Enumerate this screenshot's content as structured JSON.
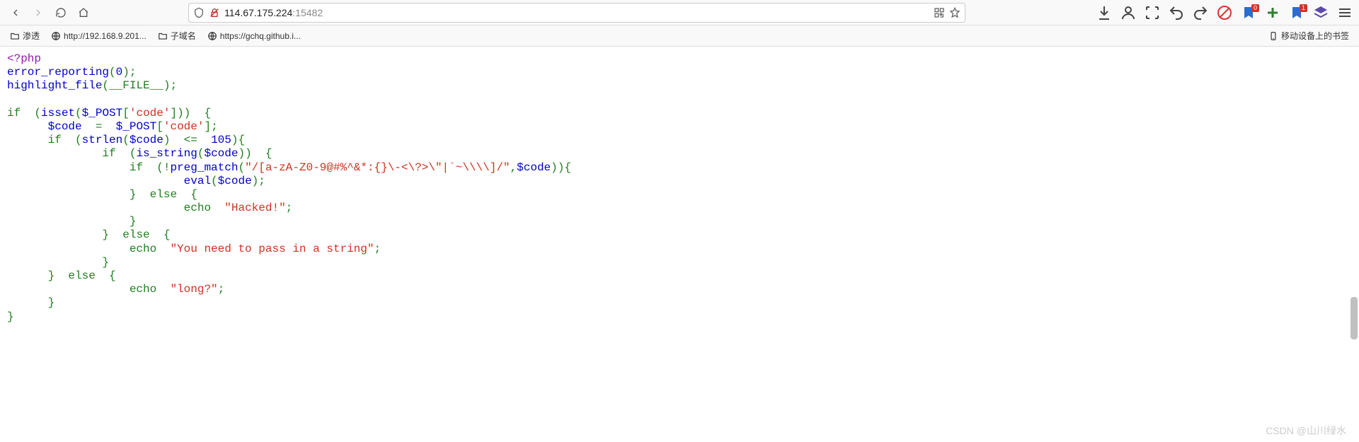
{
  "address": {
    "host": "114.67.175.224",
    "port": ":15482"
  },
  "bookmarks": {
    "b1": "渗透",
    "b2": "http://192.168.9.201...",
    "b3": "子域名",
    "b4": "https://gchq.github.i...",
    "mobile": "移动设备上的书签"
  },
  "icons": {
    "badge_notify": "0",
    "badge_ext": "1"
  },
  "code": {
    "l01_open": "<?php",
    "l02_fn": "error_reporting",
    "l02_arg": "0",
    "l03_fn": "highlight_file",
    "l03_arg": "__FILE__",
    "l05_if": "if",
    "l05_isset": "isset",
    "l05_post": "$_POST",
    "l05_key": "'code'",
    "l06_var": "$code",
    "l06_post": "$_POST",
    "l06_key": "'code'",
    "l07_if": "if",
    "l07_strlen": "strlen",
    "l07_var": "$code",
    "l07_num": "105",
    "l08_if": "if",
    "l08_isstr": "is_string",
    "l08_var": "$code",
    "l09_if": "if",
    "l09_preg": "preg_match",
    "l09_regex": "\"/[a-zA-Z0-9@#%^&*:{}\\-<\\?>\\\"|`~\\\\\\\\]/\"",
    "l09_var": "$code",
    "l10_eval": "eval",
    "l10_var": "$code",
    "l11_else": "else",
    "l12_echo": "echo",
    "l12_str": "\"Hacked!\"",
    "l14_else": "else",
    "l15_echo": "echo",
    "l15_str": "\"You need to pass in a string\"",
    "l17_else": "else",
    "l18_echo": "echo",
    "l18_str": "\"long?\""
  },
  "watermark": "CSDN @山川绿水"
}
